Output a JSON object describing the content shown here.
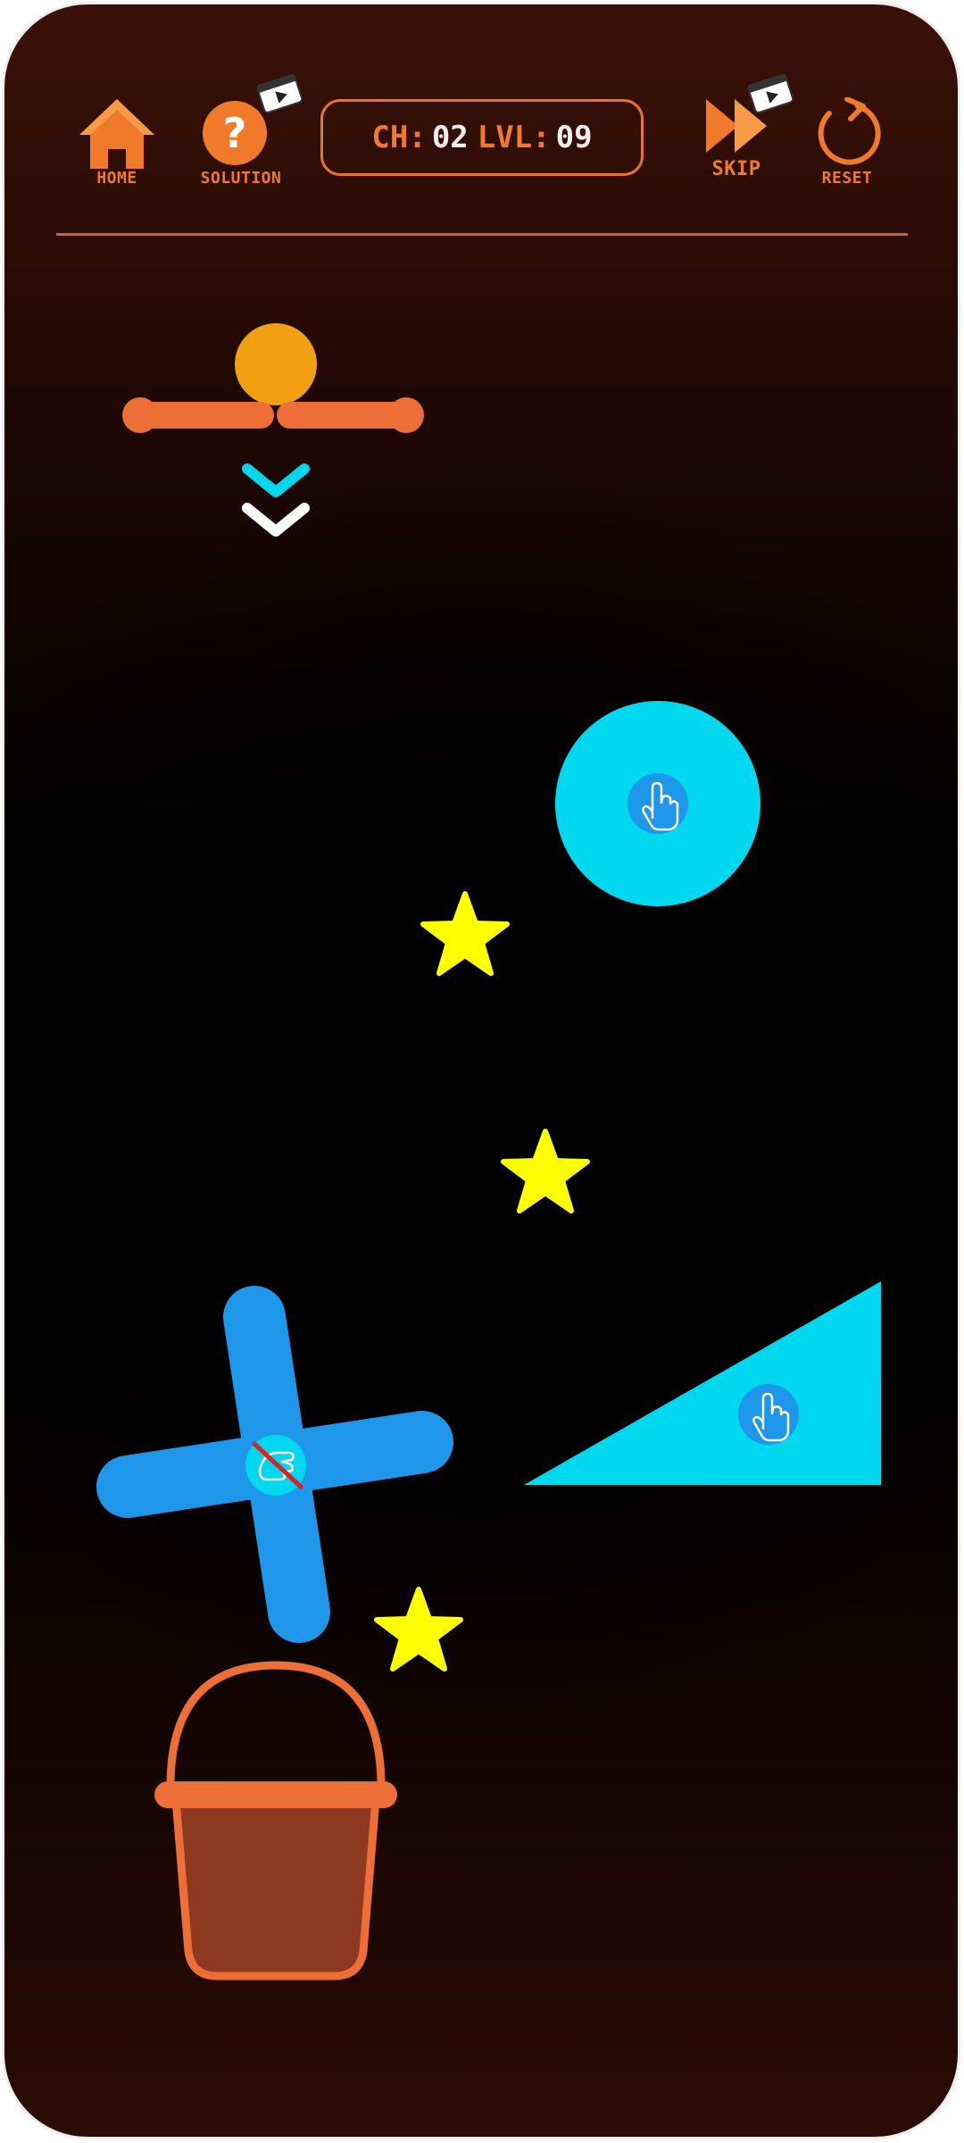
{
  "hud": {
    "home_label": "HOME",
    "solution_label": "SOLUTION",
    "skip_label": "SKIP",
    "reset_label": "RESET",
    "chapter_key": "CH:",
    "chapter_value": "02",
    "level_key": "LVL:",
    "level_value": "09",
    "solution_glyph": "?"
  },
  "icons": {
    "home": "home-icon",
    "solution": "question-icon",
    "video_ad": "video-ad-icon",
    "skip": "fast-forward-icon",
    "reset": "reset-icon",
    "tap": "tap-hand-icon",
    "no_touch": "no-touch-icon"
  },
  "colors": {
    "accent_orange": "#f07a2a",
    "ball": "#f0a010",
    "cyan_shape": "#00d8f0",
    "blue_cross": "#1e96ea",
    "star": "#ffff00",
    "bucket_rim": "#ee6e38",
    "bucket_body": "#8e3a20"
  },
  "level": {
    "stars_count": 3
  }
}
